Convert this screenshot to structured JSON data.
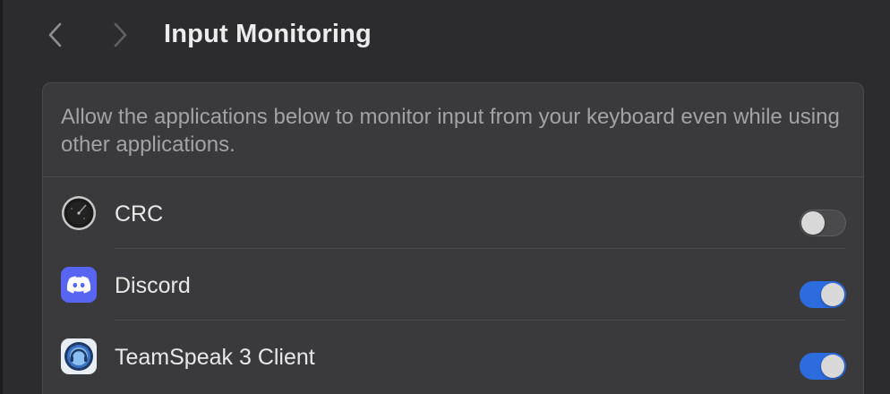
{
  "header": {
    "title": "Input Monitoring",
    "back_icon": "chevron-left-icon",
    "forward_icon": "chevron-right-icon"
  },
  "panel": {
    "description": "Allow the applications below to monitor input from your keyboard even while using other applications."
  },
  "apps": [
    {
      "name": "CRC",
      "icon": "crc-icon",
      "enabled": false
    },
    {
      "name": "Discord",
      "icon": "discord-icon",
      "enabled": true
    },
    {
      "name": "TeamSpeak 3 Client",
      "icon": "teamspeak-icon",
      "enabled": true
    }
  ],
  "colors": {
    "toggle_on": "#2d6cde",
    "toggle_off": "#4a4a4d",
    "discord_brand": "#5865f2"
  }
}
